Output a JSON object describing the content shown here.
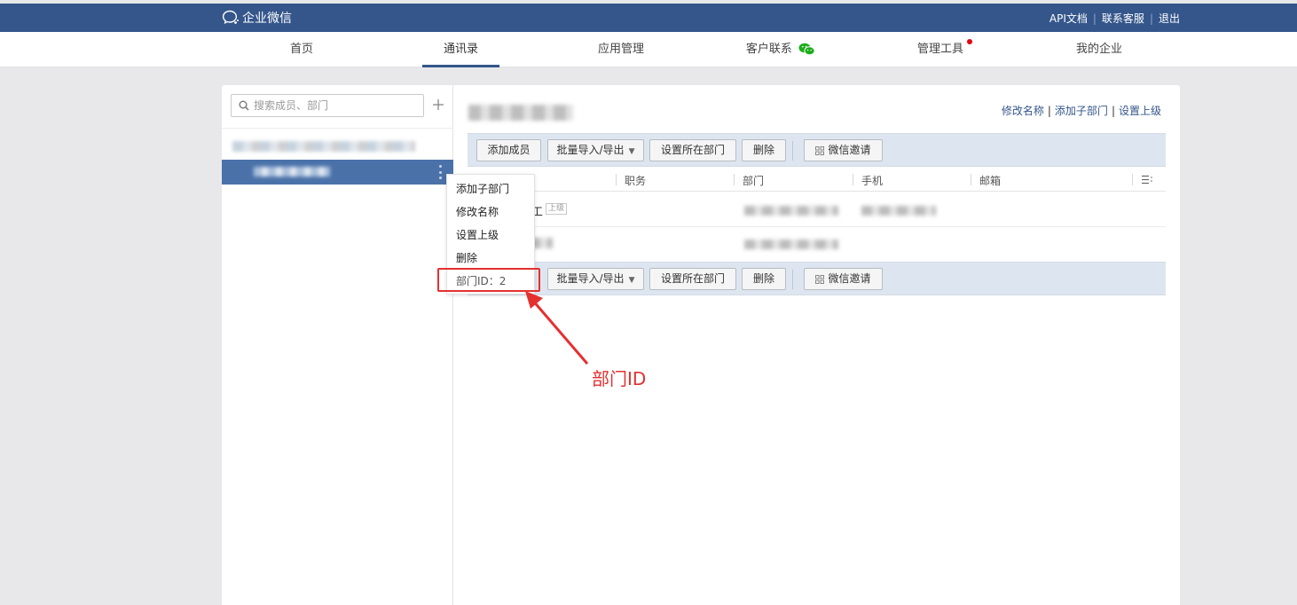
{
  "header": {
    "app_name": "企业微信",
    "links": [
      "API文档",
      "联系客服",
      "退出"
    ],
    "colors": {
      "bar": "#34568b"
    }
  },
  "nav": {
    "items": [
      "首页",
      "通讯录",
      "应用管理",
      "客户联系",
      "管理工具",
      "我的企业"
    ],
    "active": "通讯录"
  },
  "sidebar": {
    "search_placeholder": "搜索成员、部门",
    "add_icon": "plus-icon"
  },
  "content": {
    "actions": [
      "修改名称",
      "添加子部门",
      "设置上级"
    ],
    "toolbar": {
      "add_member": "添加成员",
      "batch_import_export": "批量导入/导出",
      "set_department": "设置所在部门",
      "delete": "删除",
      "wechat_invite": "微信邀请"
    },
    "table": {
      "columns": [
        "职务",
        "部门",
        "手机",
        "邮箱"
      ],
      "rows": [
        {
          "name_suffix": "工",
          "tag": "上级"
        }
      ]
    }
  },
  "context_menu": {
    "items": [
      "添加子部门",
      "修改名称",
      "设置上级",
      "删除"
    ],
    "dept_id_label": "部门ID：2"
  },
  "annotation": {
    "label": "部门ID",
    "color": "#e53030"
  }
}
